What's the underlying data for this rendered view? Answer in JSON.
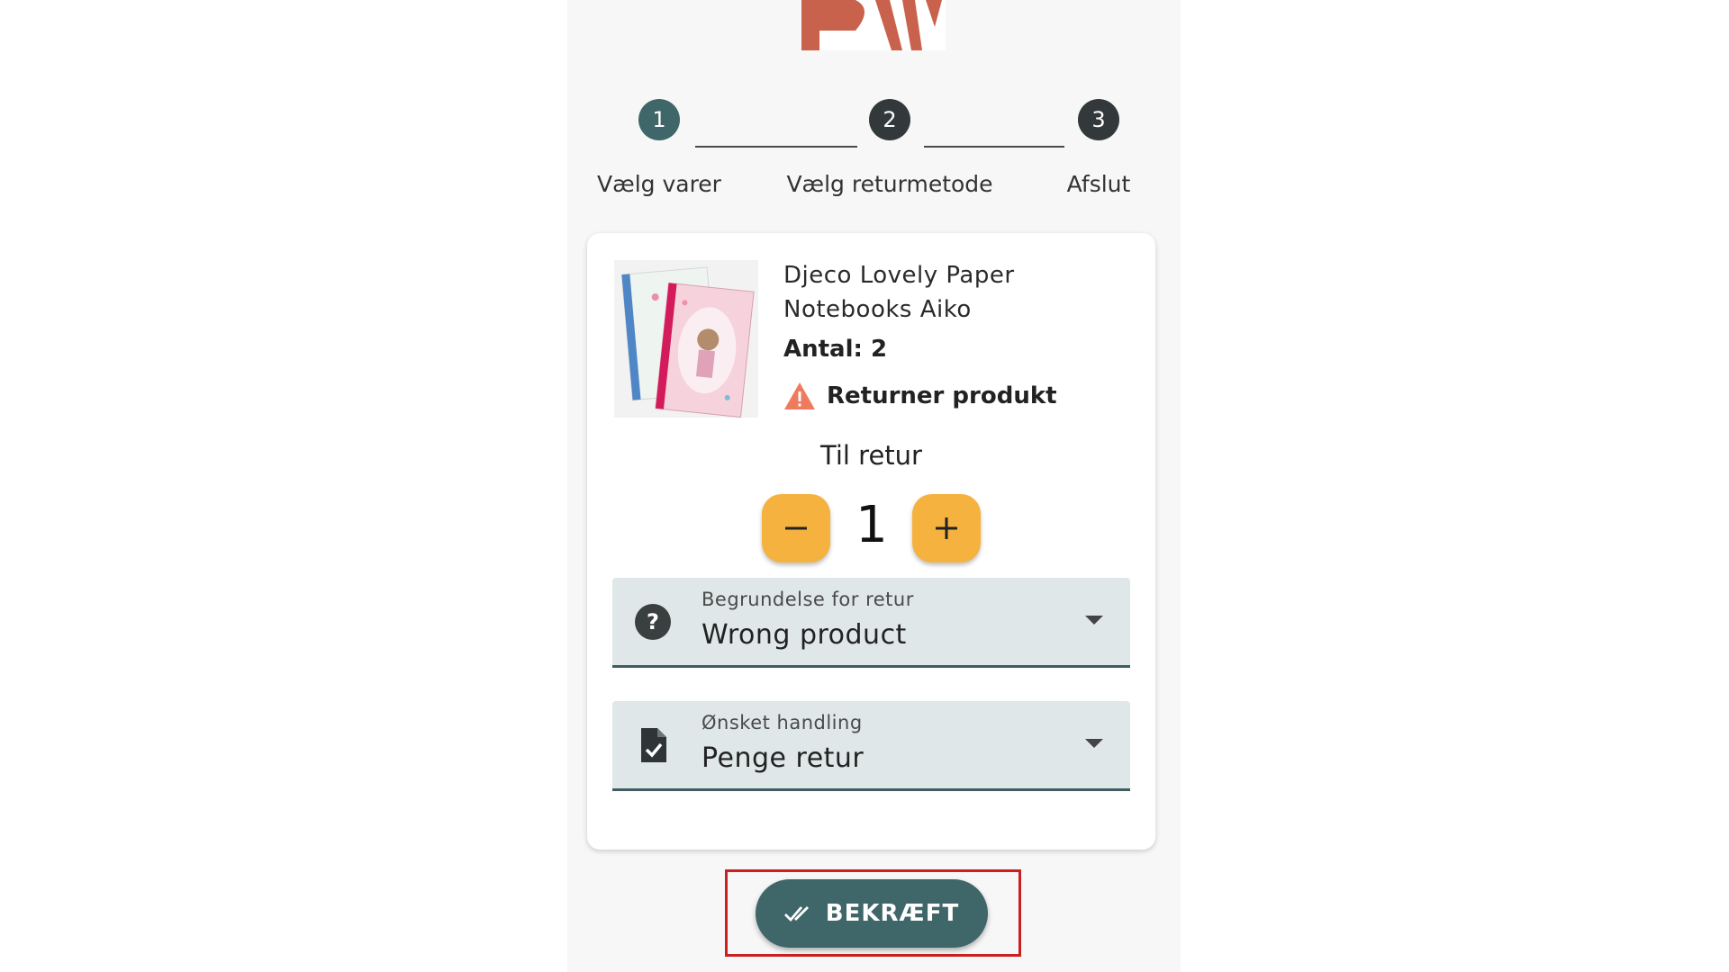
{
  "steps": [
    {
      "number": "1",
      "label": "Vælg varer"
    },
    {
      "number": "2",
      "label": "Vælg returmetode"
    },
    {
      "number": "3",
      "label": "Afslut"
    }
  ],
  "product": {
    "name": "Djeco Lovely Paper Notebooks Aiko",
    "quantity": "Antal: 2",
    "return_label": "Returner produkt"
  },
  "return_qty": {
    "heading": "Til retur",
    "value": "1",
    "decrement_icon": "minus-icon",
    "increment_icon": "plus-icon"
  },
  "reason_select": {
    "label": "Begrundelse for retur",
    "value": "Wrong product",
    "icon": "help-circle-icon"
  },
  "action_select": {
    "label": "Ønsket handling",
    "value": "Penge retur",
    "icon": "document-check-icon"
  },
  "confirm": {
    "label": "BEKRÆFT",
    "icon": "double-check-icon"
  },
  "colors": {
    "primary": "#3f6668",
    "accent": "#f5b23e",
    "logo": "#c8624c",
    "warning": "#f07a5e",
    "highlight": "#cc1f1f"
  }
}
